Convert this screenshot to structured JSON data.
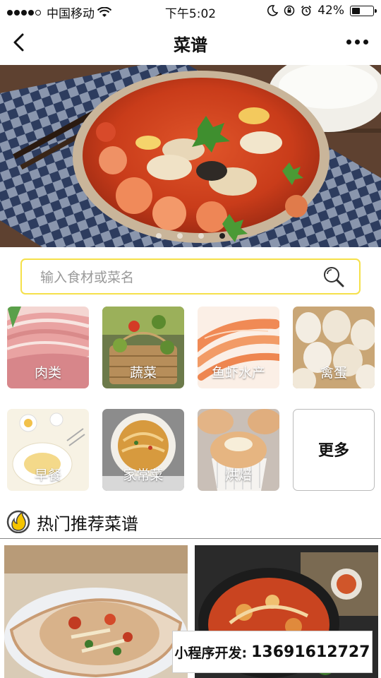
{
  "status_bar": {
    "carrier": "中国移动",
    "time": "下午5:02",
    "battery": "42%",
    "battery_level": 0.42
  },
  "nav": {
    "title": "菜谱",
    "back_icon": "chevron-left-icon",
    "more_icon": "more-dots-icon"
  },
  "banner": {
    "slide_count": 4,
    "active_index": 3
  },
  "search": {
    "placeholder": "输入食材或菜名",
    "value": ""
  },
  "categories": [
    {
      "label": "肉类"
    },
    {
      "label": "蔬菜"
    },
    {
      "label": "鱼虾水产"
    },
    {
      "label": "禽蛋"
    },
    {
      "label": "早餐"
    },
    {
      "label": "家常菜"
    },
    {
      "label": "烘焙"
    },
    {
      "label": "更多"
    }
  ],
  "section": {
    "title": "热门推荐菜谱"
  },
  "watermark": {
    "label": "小程序开发:",
    "phone": "13691612727"
  },
  "colors": {
    "search_border": "#f5e04a",
    "accent": "#f5c400"
  }
}
